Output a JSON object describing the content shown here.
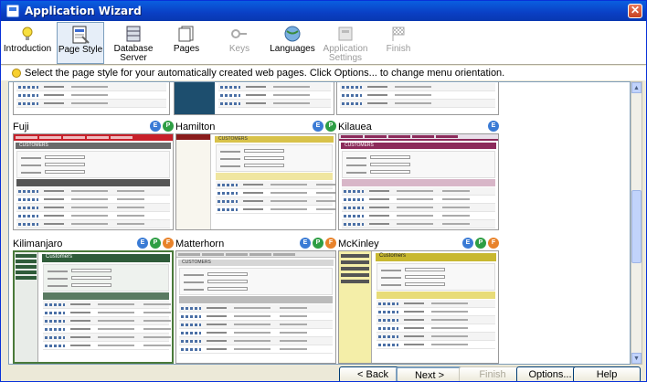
{
  "window": {
    "title": "Application Wizard"
  },
  "toolbar": {
    "items": [
      {
        "label": "Introduction",
        "icon": "lightbulb-icon"
      },
      {
        "label": "Page Style",
        "icon": "page-style-icon",
        "selected": true
      },
      {
        "label": "Database Server",
        "icon": "database-icon"
      },
      {
        "label": "Pages",
        "icon": "pages-icon"
      },
      {
        "label": "Keys",
        "icon": "keys-icon",
        "disabled": true
      },
      {
        "label": "Languages",
        "icon": "globe-icon"
      },
      {
        "label": "Application Settings",
        "icon": "settings-icon",
        "disabled": true
      },
      {
        "label": "Finish",
        "icon": "finish-flag-icon",
        "disabled": true
      }
    ]
  },
  "hint": "Select the page style for your automatically created web pages. Click Options... to change menu orientation.",
  "styles": [
    {
      "name": "Fuji",
      "badges": [
        "E",
        "P"
      ]
    },
    {
      "name": "Hamilton",
      "badges": [
        "E",
        "P"
      ]
    },
    {
      "name": "Kilauea",
      "badges": [
        "E"
      ]
    },
    {
      "name": "Kilimanjaro",
      "badges": [
        "E",
        "P",
        "F"
      ],
      "selected": true
    },
    {
      "name": "Matterhorn",
      "badges": [
        "E",
        "P",
        "F"
      ]
    },
    {
      "name": "McKinley",
      "badges": [
        "E",
        "P",
        "F"
      ]
    }
  ],
  "preview_text": {
    "customers": "Customers",
    "customers_caps": "CUSTOMERS",
    "search_for": "Search for",
    "city": "City",
    "all": "All",
    "company_name": "Company Name",
    "customer_id": "Customer ID",
    "contact_name": "Contact Name",
    "rows": [
      [
        "ALFKI",
        "Alfreds Futterkiste",
        "Maria Anders"
      ],
      [
        "ANATR",
        "Ana Trujillo Emparedados y helados",
        "Ana Trujillo"
      ],
      [
        "ANTON",
        "Antonio Moreno Taqueria",
        "Antonio Moreno"
      ],
      [
        "AROUT",
        "Around the Horn",
        "Thomas Hardy"
      ],
      [
        "BERGS",
        "Berglunds snabbkop",
        "Christina Berglund"
      ],
      [
        "BLAUS",
        "Blauer See Delikatessen",
        "Hanna Moos"
      ]
    ],
    "menu": [
      "Customers",
      "Employees",
      "Order Details",
      "Orders",
      "Products"
    ]
  },
  "buttons": {
    "back": "< Back",
    "next": "Next >",
    "finish": "Finish",
    "options": "Options...",
    "help": "Help"
  },
  "colors": {
    "fuji": "#c8202a",
    "hamilton": "#8a1c1c",
    "kilauea": "#8c2a5a",
    "kilimanjaro": "#2f5c3a",
    "matterhorn": "#d6d6d6",
    "mckinley": "#c8b830",
    "badge_e": "#3a7bd5",
    "badge_p": "#2e9e44",
    "badge_f": "#e8822a"
  }
}
